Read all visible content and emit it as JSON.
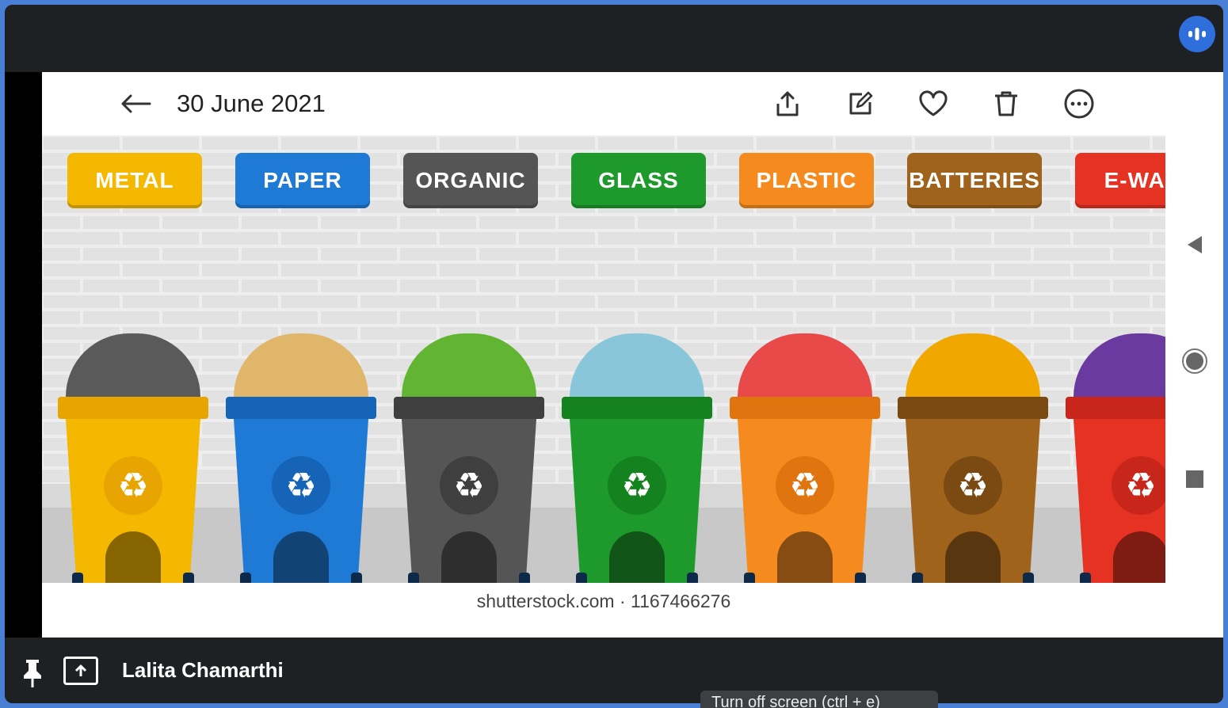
{
  "photo_viewer": {
    "title": "30 June 2021",
    "caption": "shutterstock.com · 1167466276",
    "actions": [
      "share",
      "edit",
      "favorite",
      "delete",
      "more"
    ]
  },
  "bins": [
    {
      "label": "METAL",
      "color": "#f5b800",
      "lid": "#e8a400",
      "trash": "#5a5a5a"
    },
    {
      "label": "PAPER",
      "color": "#1f7ad6",
      "lid": "#1564b8",
      "trash": "#e0b66a"
    },
    {
      "label": "ORGANIC",
      "color": "#555555",
      "lid": "#3f3f3f",
      "trash": "#62b532"
    },
    {
      "label": "GLASS",
      "color": "#1e9a2c",
      "lid": "#14821f",
      "trash": "#8ac6d9"
    },
    {
      "label": "PLASTIC",
      "color": "#f58a1f",
      "lid": "#e0740e",
      "trash": "#e84a4a"
    },
    {
      "label": "BATTERIES",
      "color": "#a0631c",
      "lid": "#7a4a12",
      "trash": "#f0a800"
    },
    {
      "label": "E-WAS",
      "color": "#e53222",
      "lid": "#c8261a",
      "trash": "#6a3aa0"
    }
  ],
  "meeting": {
    "presenter_name": "Lalita Chamarthi",
    "tooltip": "Turn off screen (ctrl + e)"
  },
  "system_nav": [
    "back-triangle",
    "home-circle",
    "recents-square"
  ]
}
